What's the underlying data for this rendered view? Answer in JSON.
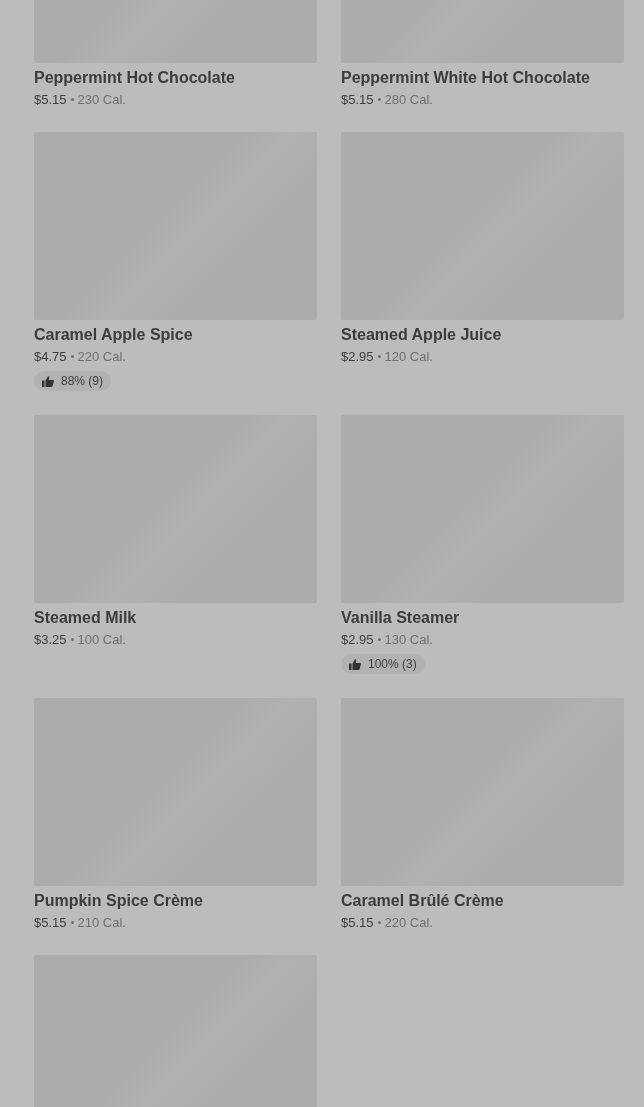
{
  "menu_items": [
    {
      "kind": "full",
      "name": "Peppermint Hot Chocolate",
      "price": "$5.15",
      "calories": "230 Cal."
    },
    {
      "kind": "full",
      "name": "Peppermint White Hot Chocolate",
      "price": "$5.15",
      "calories": "280 Cal."
    },
    {
      "kind": "full",
      "name": "Caramel Apple Spice",
      "price": "$4.75",
      "calories": "220 Cal.",
      "rating": "88% (9)"
    },
    {
      "kind": "full",
      "name": "Steamed Apple Juice",
      "price": "$2.95",
      "calories": "120 Cal."
    },
    {
      "kind": "full",
      "name": "Steamed Milk",
      "price": "$3.25",
      "calories": "100 Cal."
    },
    {
      "kind": "full",
      "name": "Vanilla Steamer",
      "price": "$2.95",
      "calories": "130 Cal.",
      "rating": "100% (3)"
    },
    {
      "kind": "full",
      "name": "Pumpkin Spice Crème",
      "price": "$5.15",
      "calories": "210 Cal."
    },
    {
      "kind": "full",
      "name": "Caramel Brûlé Crème",
      "price": "$5.15",
      "calories": "220 Cal."
    },
    {
      "kind": "image_only"
    }
  ]
}
